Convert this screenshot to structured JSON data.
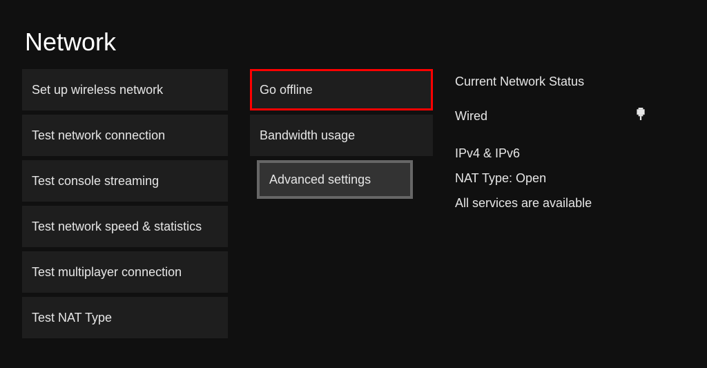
{
  "title": "Network",
  "left_menu": [
    "Set up wireless network",
    "Test network connection",
    "Test console streaming",
    "Test network speed & statistics",
    "Test multiplayer connection",
    "Test NAT Type"
  ],
  "right_menu": [
    "Go offline",
    "Bandwidth usage",
    "Advanced settings"
  ],
  "status": {
    "header": "Current Network Status",
    "connection": "Wired",
    "ip": "IPv4 & IPv6",
    "nat": "NAT Type: Open",
    "services": "All services are available"
  }
}
